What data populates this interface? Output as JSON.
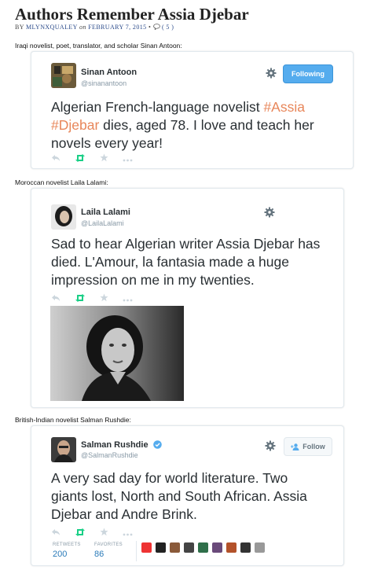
{
  "post": {
    "title": "Authors Remember Assia Djebar",
    "by": "BY",
    "author": "MLYNXQUALEY",
    "on": "on",
    "date": "FEBRUARY 7, 2015",
    "bullet": "•",
    "comments": "( 5 )"
  },
  "sections": [
    {
      "caption": "Iraqi novelist, poet, translator, and scholar Sinan Antoon:",
      "tweet": {
        "name": "Sinan Antoon",
        "handle": "@sinanantoon",
        "button": "Following",
        "text_parts": [
          "Algerian French-language novelist ",
          "#Assia",
          " ",
          "#Djebar",
          " dies, aged 78. I love and teach her novels every year!"
        ]
      }
    },
    {
      "caption": "Moroccan novelist Laila Lalami:",
      "tweet": {
        "name": "Laila Lalami",
        "handle": "@LailaLalami",
        "text": "Sad to hear Algerian writer Assia Djebar has died. L'Amour, la fantasia made a huge impression on me in my twenties."
      }
    },
    {
      "caption": "British-Indian novelist Salman Rushdie:",
      "tweet": {
        "name": "Salman Rushdie",
        "handle": "@SalmanRushdie",
        "button": "Follow",
        "text": "A very sad day for world literature. Two giants lost, North and South African. Assia Djebar and Andre Brink.",
        "retweets_label": "RETWEETS",
        "retweets": "200",
        "favorites_label": "FAVORITES",
        "favorites": "86"
      }
    }
  ],
  "colors": {
    "link": "#2a4a8a",
    "hashtag": "#e8865a",
    "follow_blue": "#55acee",
    "retweet_green": "#19cf86",
    "stat_blue": "#2b7bb9"
  }
}
